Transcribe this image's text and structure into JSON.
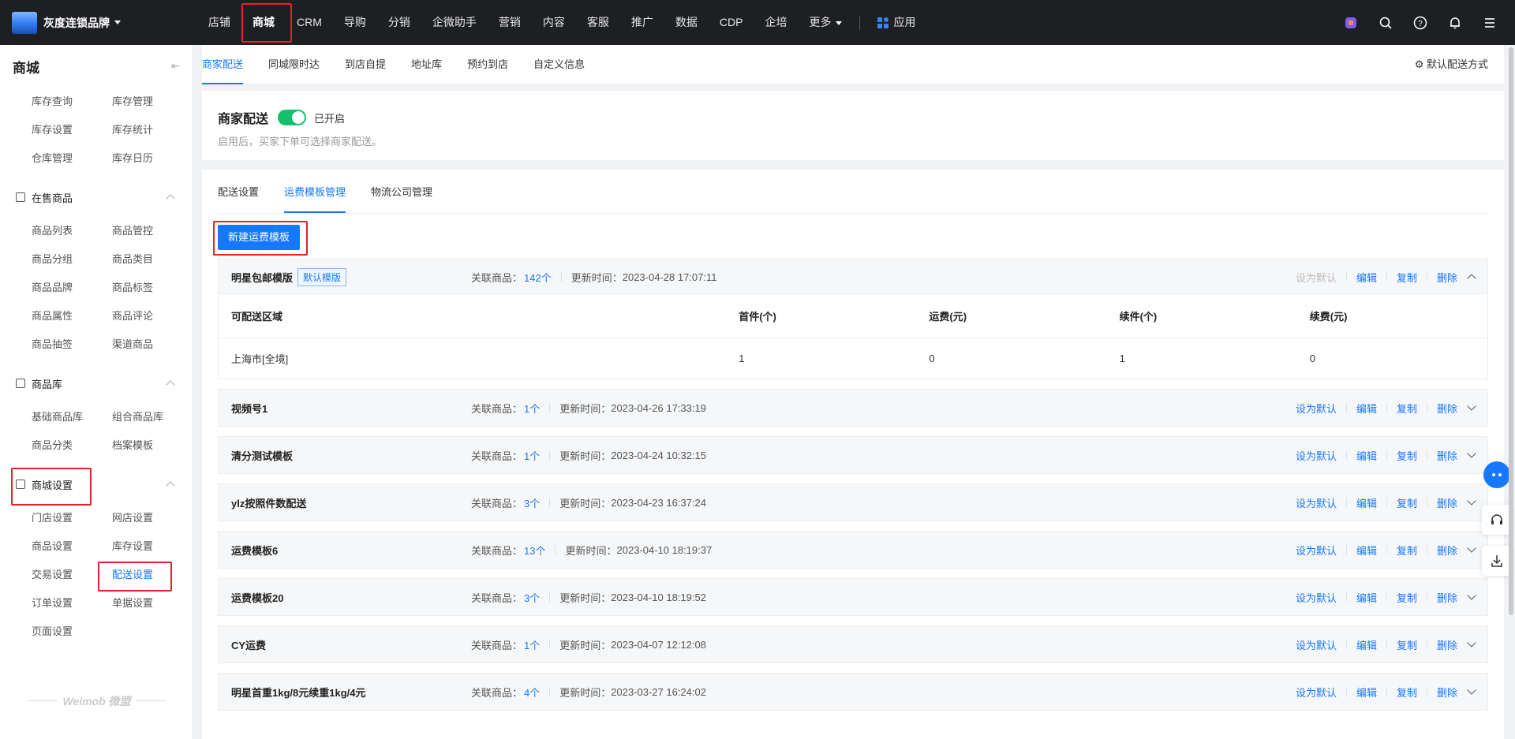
{
  "brand": {
    "name": "灰度连锁品牌"
  },
  "nav": {
    "items": [
      "店铺",
      "商城",
      "CRM",
      "导购",
      "分销",
      "企微助手",
      "营销",
      "内容",
      "客服",
      "推广",
      "数据",
      "CDP",
      "企培",
      "更多"
    ],
    "active_index": 1,
    "app_label": "应用"
  },
  "sidebar": {
    "title": "商城",
    "inventory": [
      "库存查询",
      "库存管理",
      "库存设置",
      "库存统计",
      "仓库管理",
      "库存日历"
    ],
    "groups": [
      {
        "label": "在售商品",
        "icon": "shop-bag-icon",
        "items": [
          "商品列表",
          "商品管控",
          "商品分组",
          "商品类目",
          "商品品牌",
          "商品标签",
          "商品属性",
          "商品评论",
          "商品抽签",
          "渠道商品"
        ]
      },
      {
        "label": "商品库",
        "icon": "home-icon",
        "items": [
          "基础商品库",
          "组合商品库",
          "商品分类",
          "档案模板"
        ]
      },
      {
        "label": "商城设置",
        "icon": "hexagon-settings-icon",
        "items": [
          "门店设置",
          "网店设置",
          "商品设置",
          "库存设置",
          "交易设置",
          "配送设置",
          "订单设置",
          "单据设置",
          "页面设置"
        ],
        "active_item": "配送设置"
      }
    ],
    "footer": "Weimob 微盟"
  },
  "top_tabs": {
    "items": [
      "商家配送",
      "同城限时达",
      "到店自提",
      "地址库",
      "预约到店",
      "自定义信息"
    ],
    "active": "商家配送",
    "right_label": "默认配送方式"
  },
  "merchant_delivery": {
    "title": "商家配送",
    "status": "已开启",
    "enabled": true,
    "desc": "启用后，买家下单可选择商家配送。"
  },
  "sub_tabs": {
    "items": [
      "配送设置",
      "运费模板管理",
      "物流公司管理"
    ],
    "active": "运费模板管理"
  },
  "new_template_button": "新建运费模板",
  "labels": {
    "linked": "关联商品：",
    "updated": "更新时间：",
    "set_default": "设为默认",
    "edit": "编辑",
    "copy": "复制",
    "delete": "删除"
  },
  "expanded_template": {
    "name": "明星包邮模版",
    "badge": "默认模版",
    "linked": "142个",
    "updated": "2023-04-28 17:07:11",
    "columns": [
      "可配送区域",
      "首件(个)",
      "运费(元)",
      "续件(个)",
      "续费(元)"
    ],
    "rows": [
      [
        "上海市[全境]",
        "1",
        "0",
        "1",
        "0"
      ]
    ]
  },
  "templates": [
    {
      "name": "视频号1",
      "linked": "1个",
      "updated": "2023-04-26 17:33:19"
    },
    {
      "name": "清分测试模板",
      "linked": "1个",
      "updated": "2023-04-24 10:32:15"
    },
    {
      "name": "ylz按照件数配送",
      "linked": "3个",
      "updated": "2023-04-23 16:37:24"
    },
    {
      "name": "运费模板6",
      "linked": "13个",
      "updated": "2023-04-10 18:19:37"
    },
    {
      "name": "运费模板20",
      "linked": "3个",
      "updated": "2023-04-10 18:19:52"
    },
    {
      "name": "CY运费",
      "linked": "1个",
      "updated": "2023-04-07 12:12:08"
    },
    {
      "name": "明星首重1kg/8元续重1kg/4元",
      "linked": "4个",
      "updated": "2023-03-27 16:24:02"
    }
  ],
  "colors": {
    "accent": "#1677ff",
    "topbar": "#1d1f23",
    "toggle_on": "#13c06b",
    "highlight": "#e5212b"
  }
}
